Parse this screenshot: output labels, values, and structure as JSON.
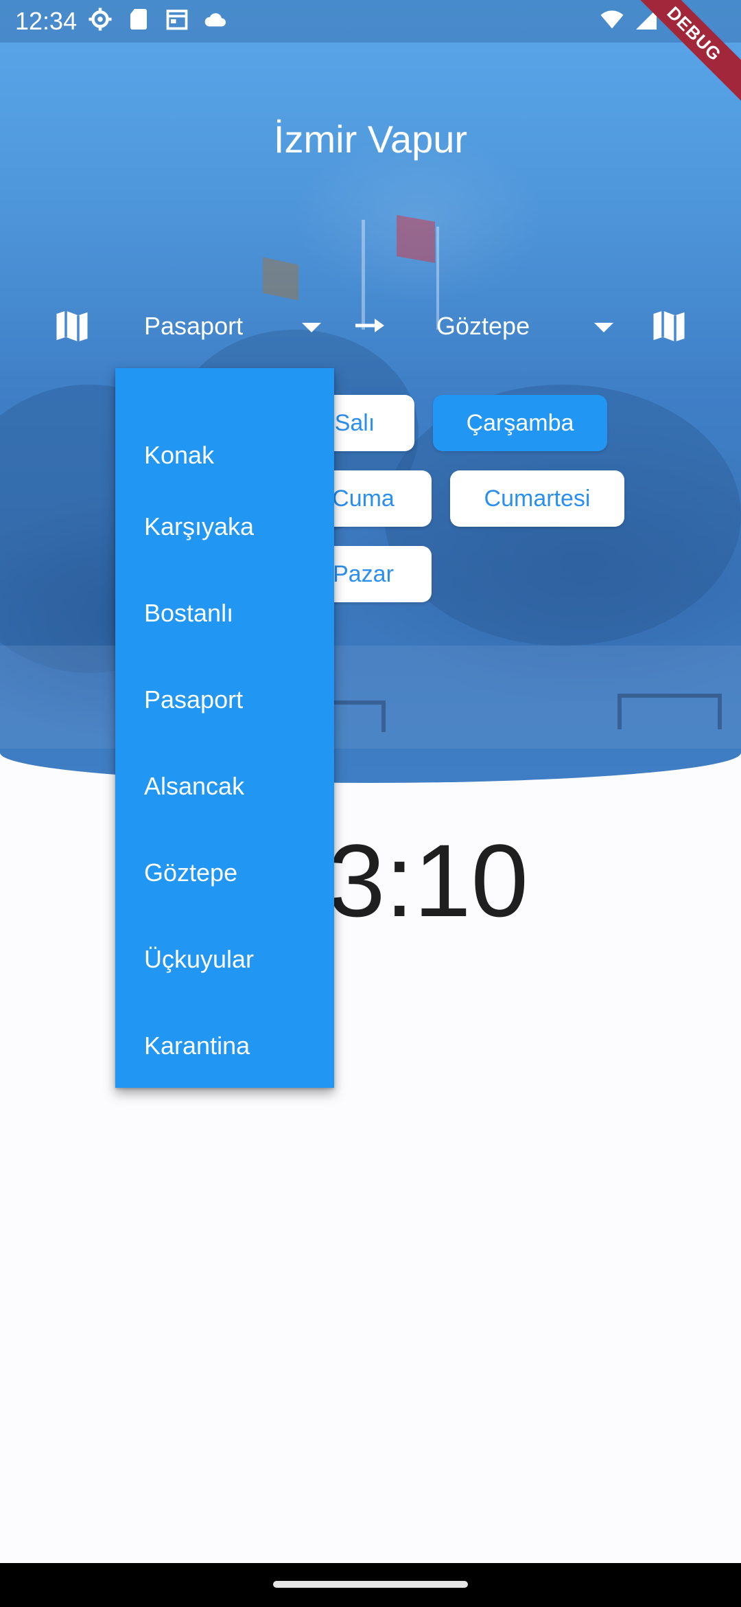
{
  "status_bar": {
    "time": "12:34",
    "left_icons": [
      "settings-icon",
      "sd-card-icon",
      "calendar-icon",
      "cloud-icon"
    ],
    "right_icons": [
      "wifi-icon",
      "signal-icon",
      "battery-icon"
    ]
  },
  "debug_banner": "DEBUG",
  "app": {
    "title": "İzmir Vapur",
    "accent_color": "#2196f3"
  },
  "route": {
    "from": "Pasaport",
    "to": "Göztepe",
    "from_icon": "map-icon",
    "to_icon": "map-icon",
    "arrow_icon": "arrow-right-icon"
  },
  "days": [
    {
      "label": "Salı",
      "selected": false
    },
    {
      "label": "Çarşamba",
      "selected": true
    },
    {
      "label": "Cuma",
      "selected": false
    },
    {
      "label": "Cumartesi",
      "selected": false
    },
    {
      "label": "Pazar",
      "selected": false
    }
  ],
  "next_departure": {
    "visible_text": "3:10"
  },
  "dropdown": {
    "items": [
      "Konak",
      "Karşıyaka",
      "Bostanlı",
      "Pasaport",
      "Alsancak",
      "Göztepe",
      "Üçkuyular",
      "Karantina"
    ]
  }
}
